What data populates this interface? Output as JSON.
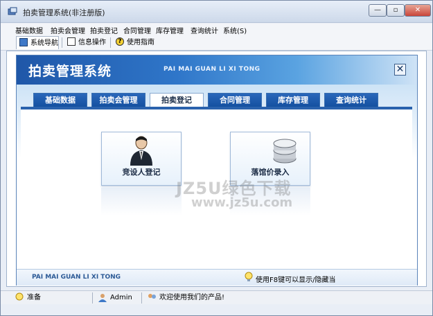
{
  "window": {
    "title": "拍卖管理系统(非注册版)"
  },
  "menu": [
    "基础数据",
    "拍卖会管理",
    "拍卖登记",
    "合同管理",
    "库存管理",
    "查询统计",
    "系统(S)"
  ],
  "toolbar": {
    "nav": "系统导航",
    "info": "信息操作",
    "help": "使用指南"
  },
  "banner": {
    "title": "拍卖管理系统",
    "pinyin": "PAI MAI GUAN LI XI TONG",
    "close": "✕"
  },
  "tabs": [
    "基础数据",
    "拍卖会管理",
    "拍卖登记",
    "合同管理",
    "库存管理",
    "查询统计"
  ],
  "active_tab": "拍卖登记",
  "cards": {
    "bidder": "竞设人登记",
    "reserve": "落馆价录入"
  },
  "watermark": {
    "line1": "JZ5U绿色下载",
    "line2": "www.jz5u.com"
  },
  "footer": {
    "pinyin": "PAI MAI GUAN LI XI TONG",
    "tip": "使用F8键可以显示/隐藏当"
  },
  "status": {
    "ready": "准备",
    "user": "Admin",
    "welcome": "欢迎使用我们的产品!"
  },
  "colors": {
    "banner": "#1f57a8",
    "tab": "#134f9f",
    "accent": "#2a62ad"
  }
}
